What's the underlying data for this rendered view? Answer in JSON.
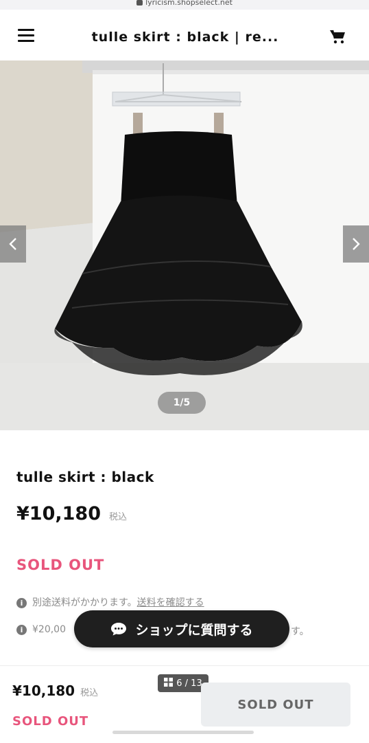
{
  "browser": {
    "url": "lyricism.shopselect.net"
  },
  "header": {
    "title": "tulle skirt : black | re...",
    "menu_icon": "hamburger-menu-icon",
    "cart_icon": "cart-icon"
  },
  "carousel": {
    "counter": "1/5",
    "prev_icon": "chevron-left-icon",
    "next_icon": "chevron-right-icon"
  },
  "product": {
    "name": "tulle skirt : black",
    "price": "¥10,180",
    "tax_label": "税込",
    "status": "SOLD OUT",
    "shipping_note": "別途送料がかかります。",
    "shipping_link": "送料を確認する",
    "free_shipping_note_start": "¥20,00",
    "free_shipping_note_end": "す。"
  },
  "chat_button": {
    "label": "ショップに質問する",
    "icon": "chat-bubble-icon"
  },
  "footer": {
    "price": "¥10,180",
    "tax_label": "税込",
    "status": "SOLD OUT",
    "page_indicator": "6 / 13",
    "button_label": "SOLD OUT"
  },
  "colors": {
    "sold_out": "#e8557c",
    "chat_button": "#1f1f1f",
    "footer_button": "#eceef0"
  }
}
